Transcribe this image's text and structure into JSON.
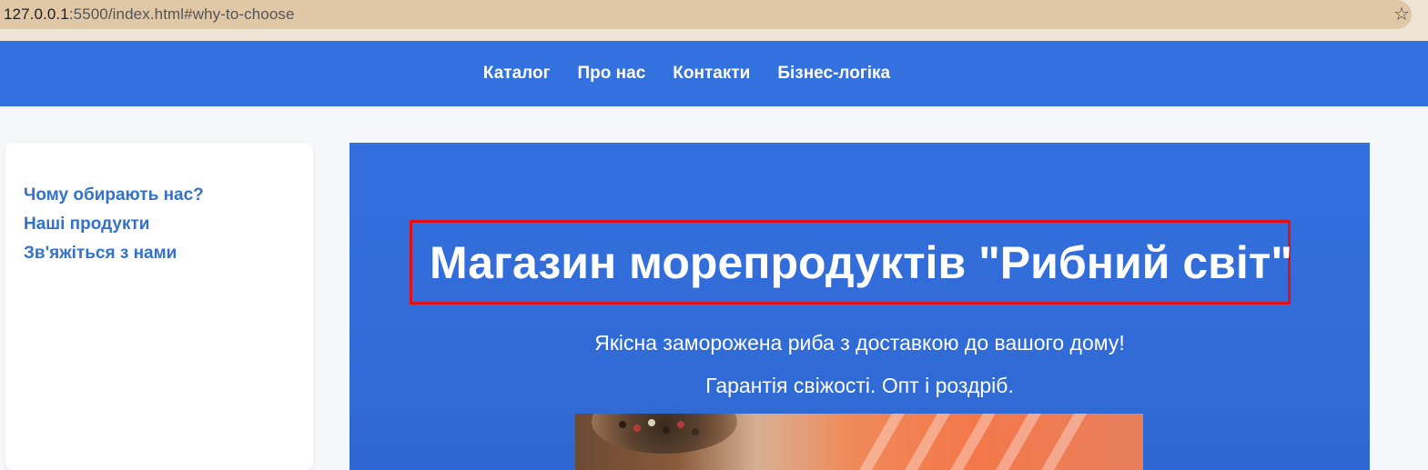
{
  "browser": {
    "url_host": "127.0.0.1",
    "url_rest": ":5500/index.html#why-to-choose",
    "bookmark_icon": "star-icon"
  },
  "nav": {
    "items": [
      {
        "label": "Каталог"
      },
      {
        "label": "Про нас"
      },
      {
        "label": "Контакти"
      },
      {
        "label": "Бізнес-логіка"
      }
    ]
  },
  "sidebar": {
    "items": [
      {
        "label": "Чому обирають нас?"
      },
      {
        "label": "Наші продукти"
      },
      {
        "label": "Зв'яжіться з нами"
      }
    ]
  },
  "hero": {
    "title": "Магазин морепродуктів \"Рибний світ\"",
    "subtitle1": "Якісна заморожена риба з доставкою до вашого дому!",
    "subtitle2": "Гарантія свіжості. Опт і роздріб."
  },
  "colors": {
    "nav_bg": "#3372de",
    "hero_bg": "#3370de",
    "highlight_border": "#e0101a",
    "sidebar_link": "#3372c8"
  }
}
